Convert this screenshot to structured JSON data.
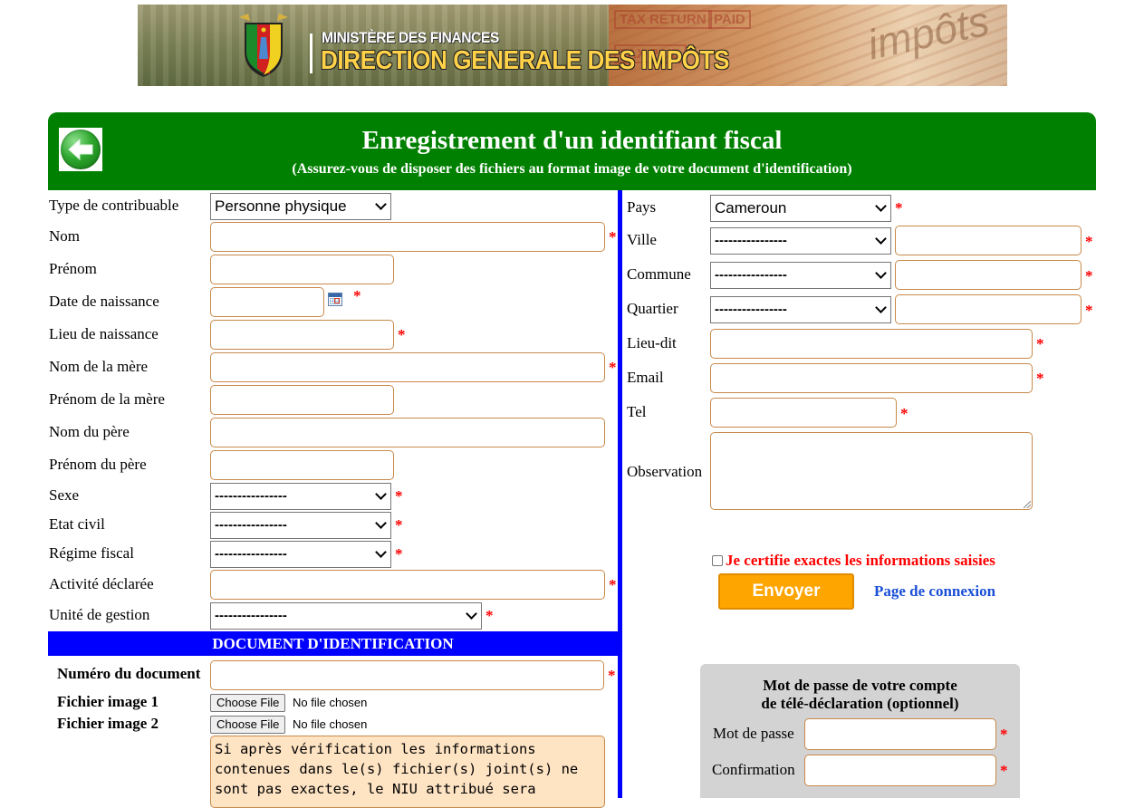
{
  "banner": {
    "line1": "MINISTÈRE DES FINANCES",
    "line2": "DIRECTION GENERALE DES IMPÔTS",
    "stamps": [
      "TAX RETURN",
      "PAID",
      "TAX PAID"
    ],
    "watermark": "impôts"
  },
  "header": {
    "back_icon": "back-arrow-icon",
    "title": "Enregistrement d'un identifiant fiscal",
    "subtitle": "(Assurez-vous de disposer des fichiers au format image de votre document d'identification)"
  },
  "left_form": {
    "type_contribuable": {
      "label": "Type de contribuable",
      "value": "Personne physique"
    },
    "nom": {
      "label": "Nom",
      "value": ""
    },
    "prenom": {
      "label": "Prénom",
      "value": ""
    },
    "date_naissance": {
      "label": "Date de naissance",
      "value": ""
    },
    "lieu_naissance": {
      "label": "Lieu de naissance",
      "value": ""
    },
    "nom_mere": {
      "label": "Nom de la mère",
      "value": ""
    },
    "prenom_mere": {
      "label": "Prénom de la mère",
      "value": ""
    },
    "nom_pere": {
      "label": "Nom du père",
      "value": ""
    },
    "prenom_pere": {
      "label": "Prénom du père",
      "value": ""
    },
    "sexe": {
      "label": "Sexe",
      "value": "----------------"
    },
    "etat_civil": {
      "label": "Etat civil",
      "value": "----------------"
    },
    "regime_fiscal": {
      "label": "Régime fiscal",
      "value": "----------------"
    },
    "activite": {
      "label": "Activité déclarée",
      "value": ""
    },
    "unite_gestion": {
      "label": "Unité de gestion",
      "value": "----------------"
    }
  },
  "required_mark": "*",
  "document": {
    "section_title": "DOCUMENT D'IDENTIFICATION",
    "numero": {
      "label": "Numéro du document",
      "value": ""
    },
    "fichier1": {
      "label": "Fichier image 1",
      "button": "Choose File",
      "status": "No file chosen"
    },
    "fichier2": {
      "label": "Fichier image 2",
      "button": "Choose File",
      "status": "No file chosen"
    },
    "notice": "Si après vérification les informations contenues dans le(s) fichier(s) joint(s) ne sont pas exactes, le NIU attribué sera"
  },
  "right_form": {
    "pays": {
      "label": "Pays",
      "value": "Cameroun"
    },
    "ville": {
      "label": "Ville",
      "value": "----------------",
      "text": ""
    },
    "commune": {
      "label": "Commune",
      "value": "----------------",
      "text": ""
    },
    "quartier": {
      "label": "Quartier",
      "value": "----------------",
      "text": ""
    },
    "lieu_dit": {
      "label": "Lieu-dit",
      "value": ""
    },
    "email": {
      "label": "Email",
      "value": ""
    },
    "tel": {
      "label": "Tel",
      "value": ""
    },
    "observation": {
      "label": "Observation",
      "value": ""
    }
  },
  "actions": {
    "certify_label": "Je certifie exactes les informations saisies",
    "certify_checked": false,
    "send_label": "Envoyer",
    "login_link": "Page de connexion"
  },
  "password_box": {
    "title_line1": "Mot de passe de votre compte",
    "title_line2": "de télé-déclaration (optionnel)",
    "password_label": "Mot de passe",
    "confirm_label": "Confirmation"
  },
  "colors": {
    "header_green": "#008000",
    "divider_blue": "#0000ff",
    "required_red": "#ff0000",
    "send_orange": "#ffa500",
    "input_border": "#c8894a",
    "notice_bg": "#ffe4c4",
    "password_box_bg": "#d3d3d3",
    "link_blue": "#1a4fd6"
  }
}
